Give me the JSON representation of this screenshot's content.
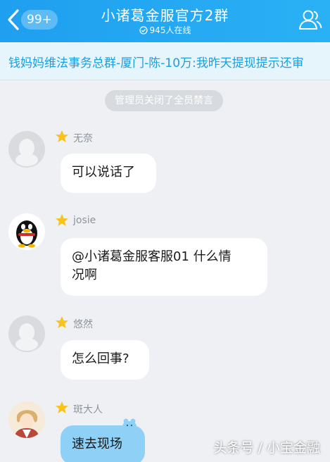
{
  "header": {
    "unread_badge": "99+",
    "title": "小诸葛金服官方2群",
    "online_count": "945人在线"
  },
  "marquee": {
    "text": "钱妈妈维法事务总群-厦门-陈-10万:我昨天提现提示还审"
  },
  "system_notice": "管理员关闭了全员禁言",
  "messages": [
    {
      "sender": "无奈",
      "text": "可以说话了"
    },
    {
      "sender": "josie",
      "text_line1": "@小诸葛金服客服01 什么情",
      "text_line2": "况啊"
    },
    {
      "sender": "悠然",
      "text": "怎么回事?"
    },
    {
      "sender": "斑大人",
      "text": "速去现场"
    }
  ],
  "watermark": "头条号 / 小宝金融",
  "colors": {
    "header": "#1f9fef",
    "accent": "#1a9fe0",
    "bubble_blue": "#8fd0f7",
    "star": "#f7c31c"
  }
}
